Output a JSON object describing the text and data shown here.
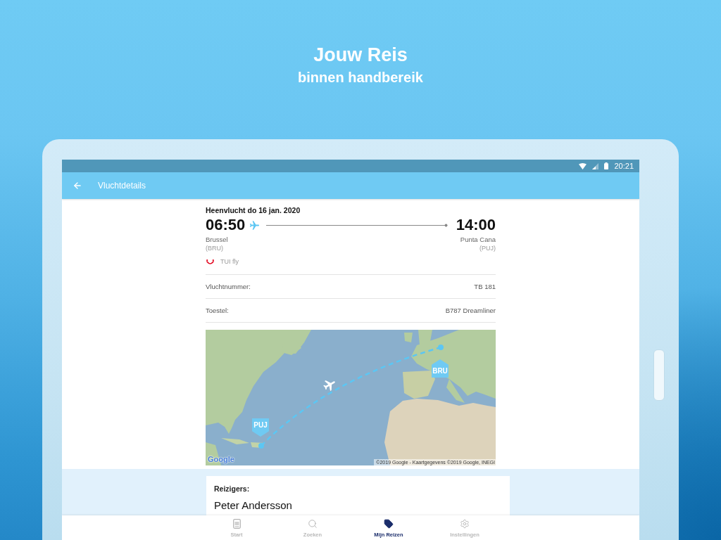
{
  "header": {
    "title": "Jouw Reis",
    "subtitle": "binnen handbereik"
  },
  "status_bar": {
    "time": "20:21"
  },
  "app_bar": {
    "title": "Vluchtdetails"
  },
  "flight": {
    "heading": "Heenvlucht do 16 jan. 2020",
    "departure": {
      "time": "06:50",
      "city": "Brussel",
      "code": "(BRU)"
    },
    "arrival": {
      "time": "14:00",
      "city": "Punta Cana",
      "code": "(PUJ)"
    },
    "airline": "TUI fly"
  },
  "details": [
    {
      "label": "Vluchtnummer:",
      "value": "TB 181"
    },
    {
      "label": "Toestel:",
      "value": "B787 Dreamliner"
    }
  ],
  "map": {
    "markers": [
      {
        "label": "PUJ",
        "kind": "down"
      },
      {
        "label": "BRU",
        "kind": "up"
      }
    ],
    "logo": "Google",
    "attribution": "©2019 Google - Kaartgegevens ©2019 Google, INEGI"
  },
  "travellers": {
    "heading": "Reizigers:",
    "names": [
      "Peter Andersson"
    ]
  },
  "bottom_nav": [
    {
      "label": "Start",
      "selected": false
    },
    {
      "label": "Zoeken",
      "selected": false
    },
    {
      "label": "Mijn Reizen",
      "selected": true
    },
    {
      "label": "Instellingen",
      "selected": false
    }
  ]
}
